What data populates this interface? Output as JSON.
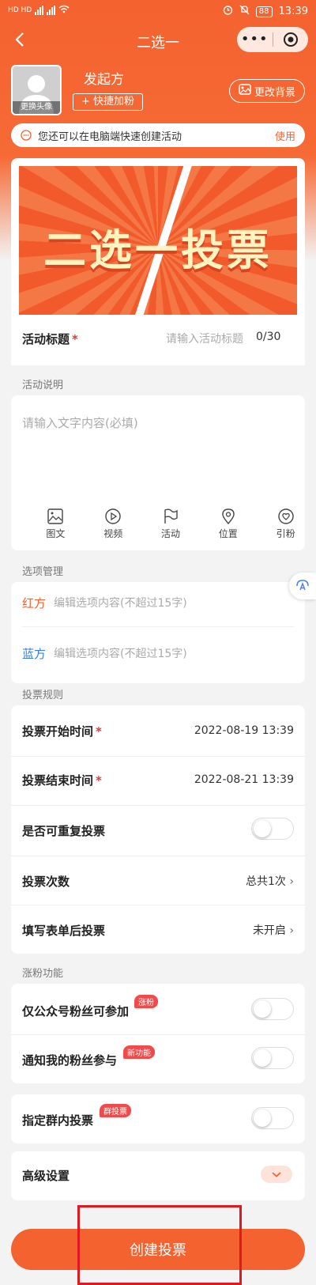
{
  "status_bar": {
    "left_text": "HD HD",
    "battery": "88",
    "time": "13:39"
  },
  "nav": {
    "title": "二选一",
    "more_label": "•••"
  },
  "profile": {
    "avatar_label": "更换头像",
    "initiator": "发起方",
    "quick_fans": "+ 快捷加粉",
    "change_bg": "更改背景"
  },
  "tip": {
    "text": "您还可以在电脑端快速创建活动",
    "action": "使用"
  },
  "banner": {
    "text": "二选一投票"
  },
  "title_row": {
    "label": "活动标题",
    "required": "*",
    "placeholder": "请输入活动标题",
    "counter": "0/30"
  },
  "description": {
    "section": "活动说明",
    "placeholder": "请输入文字内容(必填)",
    "tools": [
      "图文",
      "视频",
      "活动",
      "位置",
      "引粉"
    ]
  },
  "options": {
    "section": "选项管理",
    "items": [
      {
        "label": "红方",
        "placeholder": "编辑选项内容(不超过15字)",
        "color": "#f4622f"
      },
      {
        "label": "蓝方",
        "placeholder": "编辑选项内容(不超过15字)",
        "color": "#3b7ddd"
      }
    ]
  },
  "rules": {
    "section": "投票规则",
    "start_label": "投票开始时间",
    "start_value": "2022-08-19 13:39",
    "end_label": "投票结束时间",
    "end_value": "2022-08-21 13:39",
    "repeat_label": "是否可重复投票",
    "count_label": "投票次数",
    "count_value": "总共1次",
    "form_label": "填写表单后投票",
    "form_value": "未开启"
  },
  "fans": {
    "section": "涨粉功能",
    "only_fans_label": "仅公众号粉丝可参加",
    "only_fans_badge": "涨粉",
    "notify_label": "通知我的粉丝参与",
    "notify_badge": "新功能",
    "group_label": "指定群内投票",
    "group_badge": "群投票"
  },
  "advanced": {
    "label": "高级设置"
  },
  "create_button": "创建投票",
  "colors": {
    "accent": "#f4622f",
    "blue_option": "#3b7ddd",
    "badge": "#f14a4a",
    "highlight": "#e0181f"
  }
}
